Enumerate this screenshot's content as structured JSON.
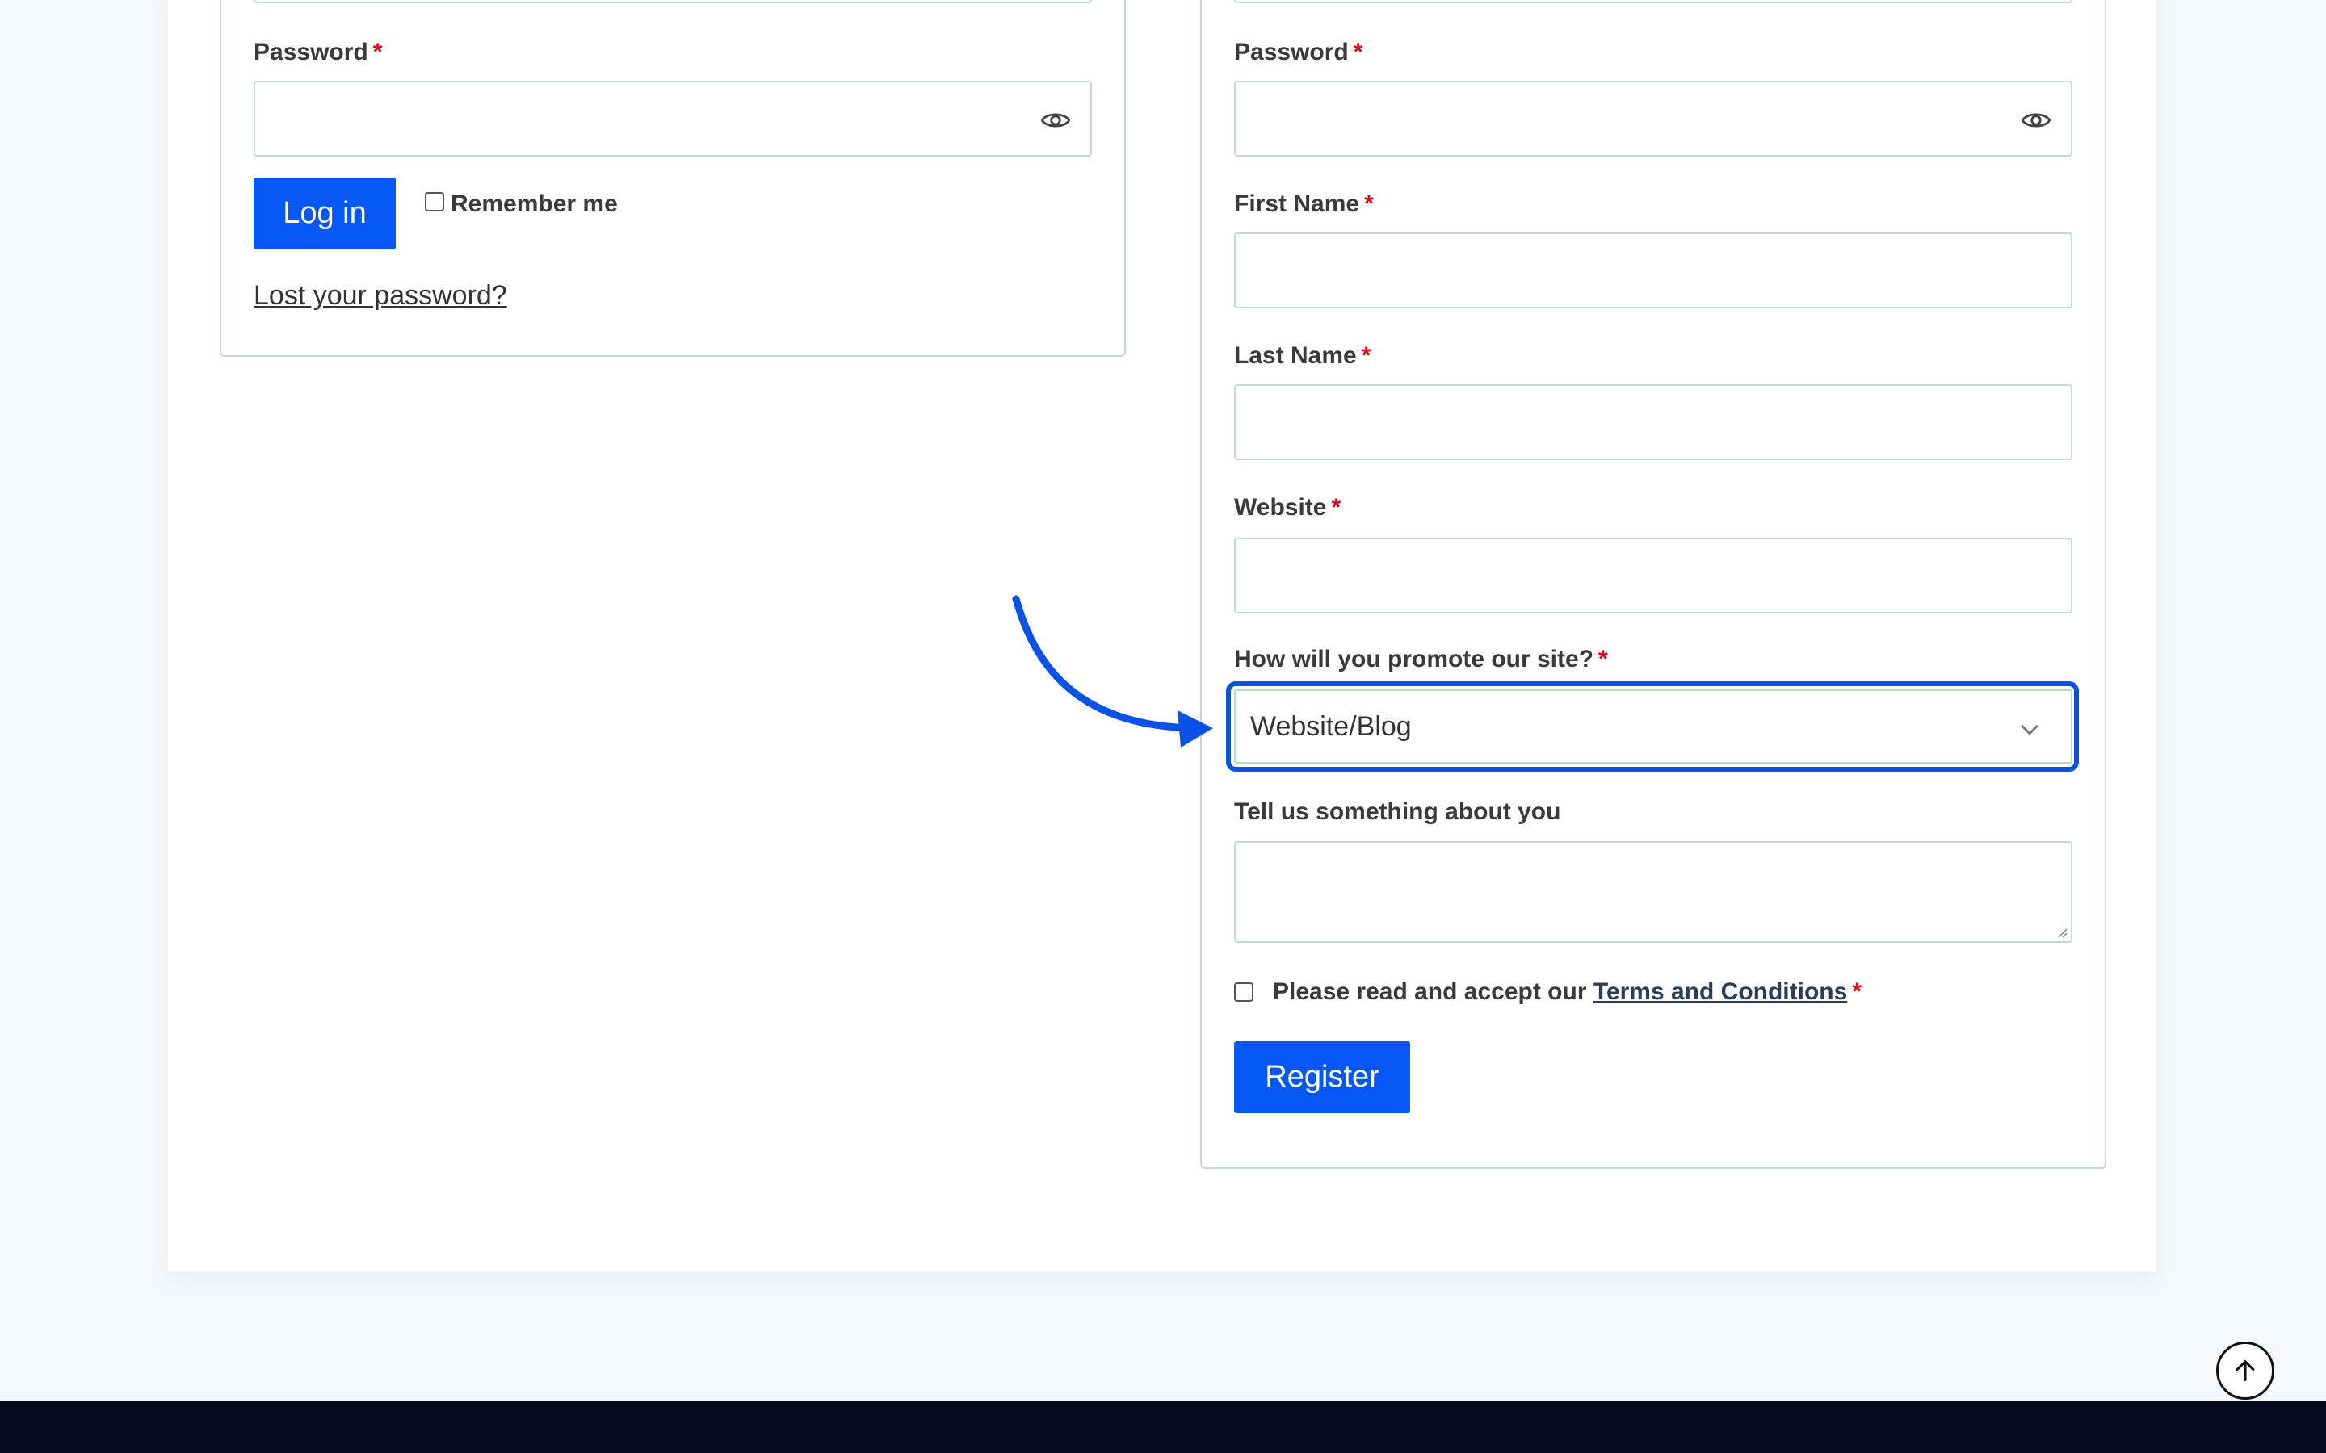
{
  "login": {
    "password_label": "Password",
    "required_mark": "*",
    "login_button": "Log in",
    "remember_me": "Remember me",
    "lost_password": "Lost your password?"
  },
  "register": {
    "password_label": "Password",
    "first_name_label": "First Name",
    "last_name_label": "Last Name",
    "website_label": "Website",
    "promote_label": "How will you promote our site?",
    "promote_selected": "Website/Blog",
    "about_label": "Tell us something about you",
    "terms_prefix": "Please read and accept our ",
    "terms_link": "Terms and Conditions",
    "required_mark": "*",
    "register_button": "Register"
  },
  "icons": {
    "password_toggle": "eye-icon",
    "select_arrow": "chevron-down-icon",
    "scroll_top": "arrow-up-icon",
    "annotation": "curved-arrow-icon"
  },
  "colors": {
    "primary_button": "#0757f7",
    "required": "#e0001a",
    "highlight": "#0a52e6",
    "footer": "#070a1f"
  }
}
